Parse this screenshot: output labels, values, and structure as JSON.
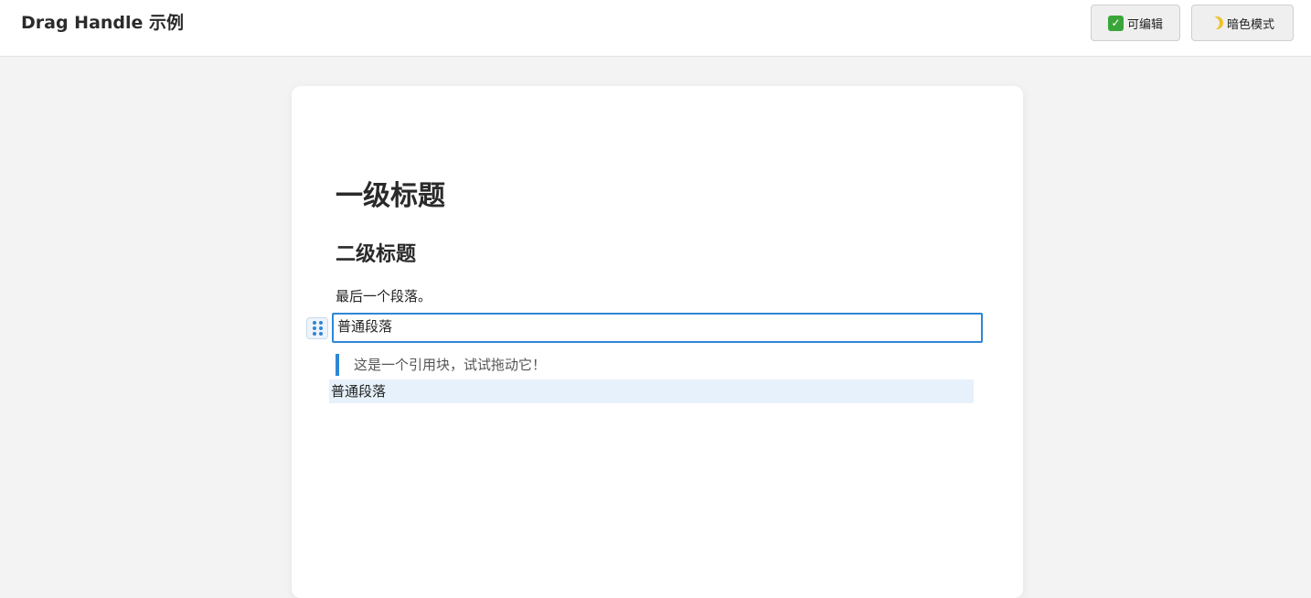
{
  "header": {
    "title": "Drag Handle 示例",
    "edit_button": {
      "icon": "checkmark-icon",
      "label": "可编辑"
    },
    "dark_button": {
      "icon": "moon-icon",
      "label": "暗色模式"
    }
  },
  "editor": {
    "heading1": "一级标题",
    "heading2": "二级标题",
    "paragraph": "最后一个段落。",
    "focused_block": "普通段落",
    "blockquote": "这是一个引用块，试试拖动它！",
    "drag_preview": "普通段落",
    "drag_handle_icon": "grip-dots-icon"
  },
  "colors": {
    "accent": "#2f86d6",
    "drop_preview_bg": "#e7f1fb"
  }
}
